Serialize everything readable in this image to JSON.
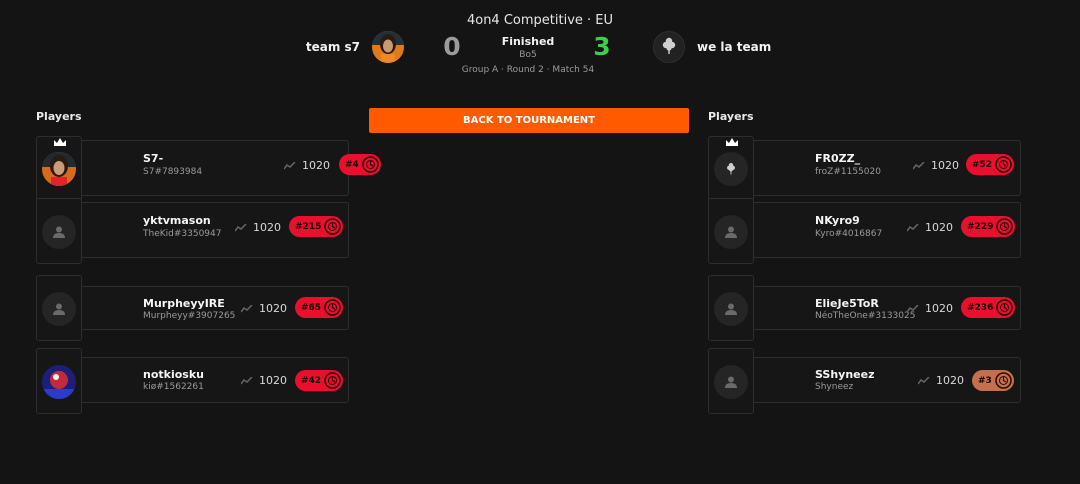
{
  "match": {
    "title": "4on4 Competitive · EU",
    "status": "Finished",
    "format": "Bo5",
    "meta": "Group A · Round 2 · Match 54"
  },
  "team_left": {
    "name": "team s7",
    "score": "0"
  },
  "team_right": {
    "name": "we la team",
    "score": "3"
  },
  "players_label": "Players",
  "back_button": "BACK TO TOURNAMENT",
  "left_players": [
    {
      "name": "S7-",
      "tag": "S7#7893984",
      "elo": "1020",
      "rank": "#4",
      "captain": true
    },
    {
      "name": "yktvmason",
      "tag": "TheKid#3350947",
      "elo": "1020",
      "rank": "#215",
      "captain": false
    },
    {
      "name": "MurpheyyIRE",
      "tag": "Murpheyy#3907265",
      "elo": "1020",
      "rank": "#65",
      "captain": false
    },
    {
      "name": "notkiosku",
      "tag": "kiø#1562261",
      "elo": "1020",
      "rank": "#42",
      "captain": false
    }
  ],
  "right_players": [
    {
      "name": "FR0ZZ_",
      "tag": "froZ#1155020",
      "elo": "1020",
      "rank": "#52",
      "captain": true
    },
    {
      "name": "NKyro9",
      "tag": "Kyro#4016867",
      "elo": "1020",
      "rank": "#229",
      "captain": false
    },
    {
      "name": "ElieJe5ToR",
      "tag": "NéoTheOne#3133025",
      "elo": "1020",
      "rank": "#236",
      "captain": false
    },
    {
      "name": "SShyneez",
      "tag": "Shyneez",
      "elo": "1020",
      "rank": "#3",
      "captain": false
    }
  ],
  "colors": {
    "accent": "#ff5a00",
    "win_score": "#3fce46",
    "loss_score": "#9b9b9b",
    "rank_red": "#e8102e",
    "rank_bronze": "#c4704c"
  },
  "icons": [
    "crown-icon",
    "default-avatar-icon",
    "trend-icon",
    "rank-emblem-icon",
    "clover-logo-icon"
  ]
}
